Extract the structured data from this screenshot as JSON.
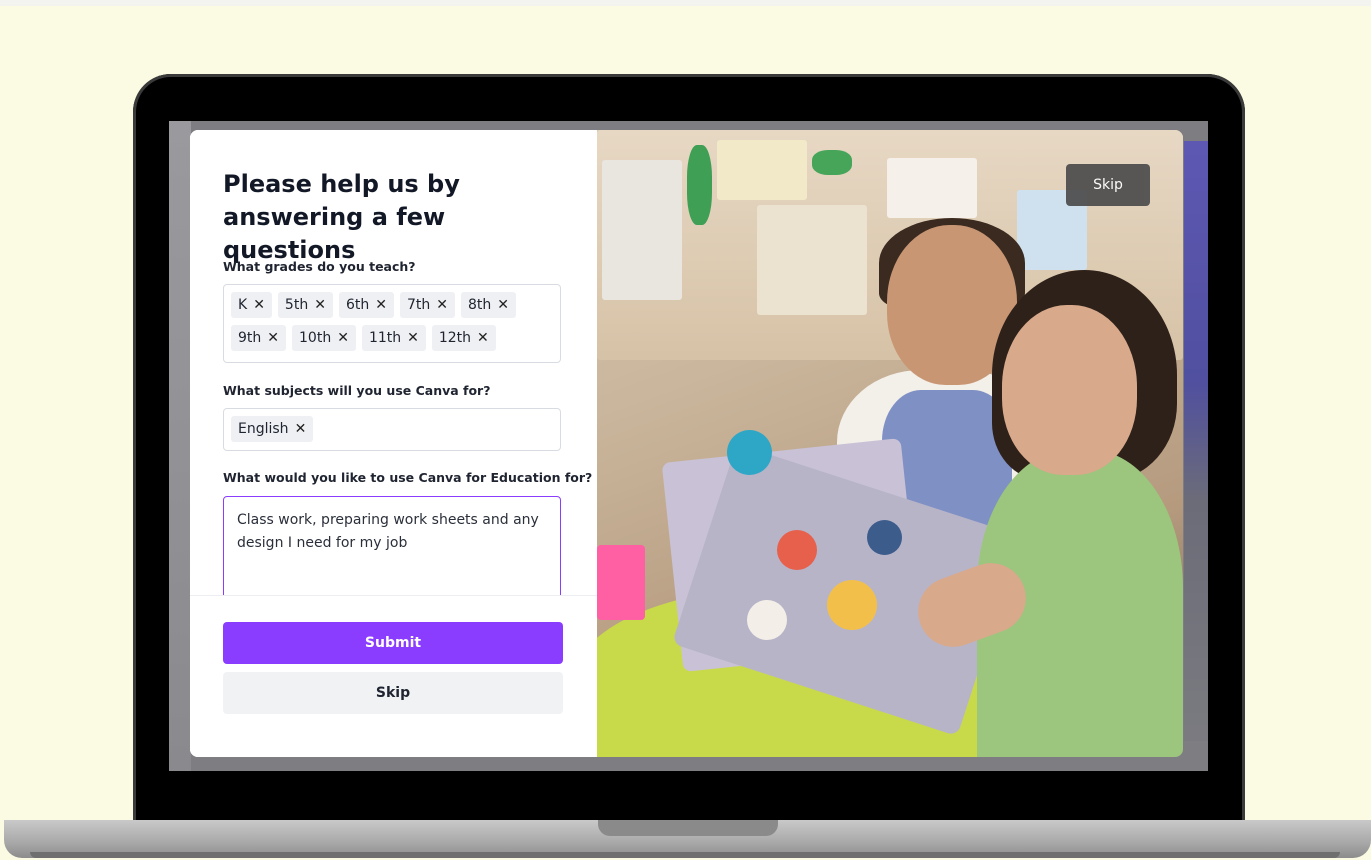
{
  "modal": {
    "title": "Please help us by\nanswering a few questions",
    "questions": {
      "grades_label": "What grades do you teach?",
      "grades": [
        "K",
        "5th",
        "6th",
        "7th",
        "8th",
        "9th",
        "10th",
        "11th",
        "12th"
      ],
      "subjects_label": "What subjects will you use Canva for?",
      "subjects": [
        "English"
      ],
      "use_label": "What would you like to use Canva for Education for?",
      "use_value": "Class work, preparing work sheets and any design I need for my job"
    },
    "remove_glyph": "✕",
    "submit_label": "Submit",
    "skip_label": "Skip",
    "photo_skip_label": "Skip"
  },
  "colors": {
    "accent": "#8b3dff",
    "background": "#fbfae2"
  },
  "icons": {
    "chip_remove": "close-icon"
  }
}
